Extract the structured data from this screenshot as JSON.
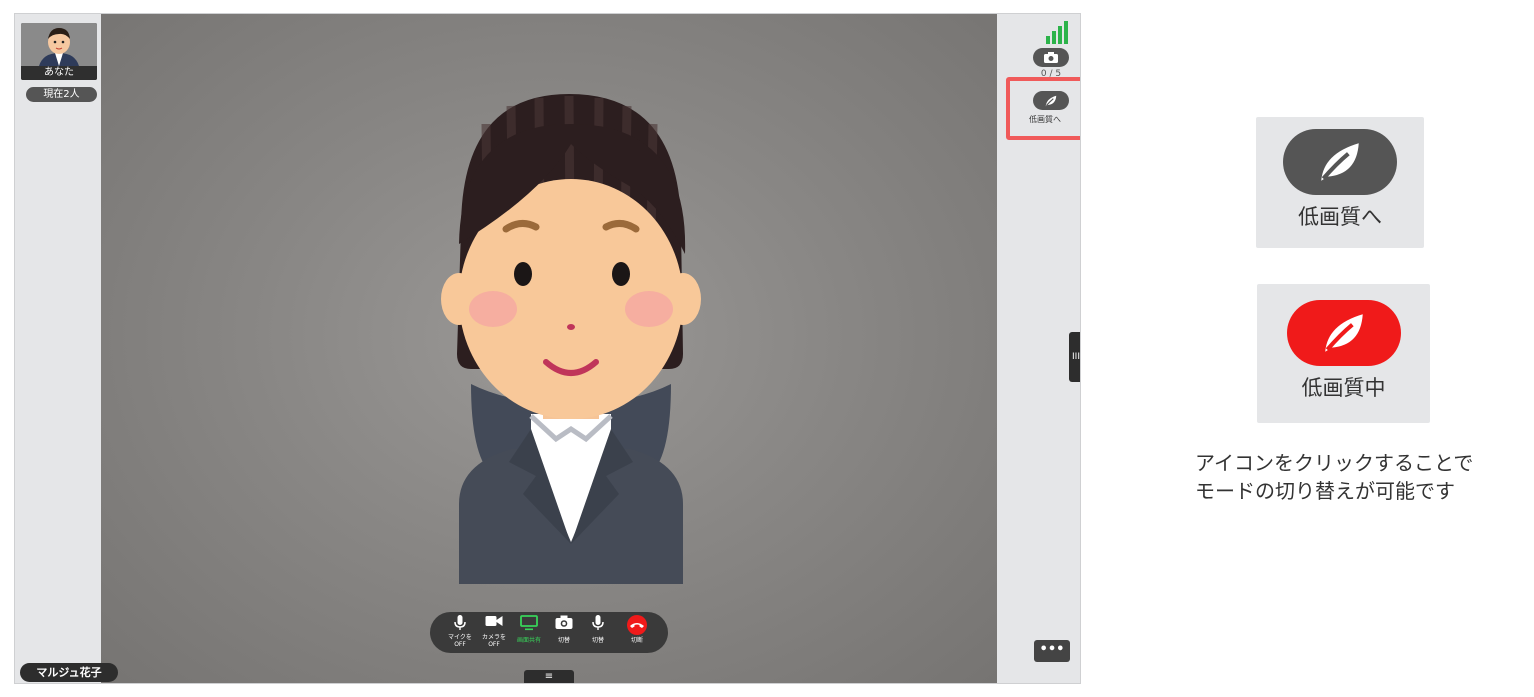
{
  "call": {
    "self_label": "あなた",
    "participant_count": "現在2人",
    "remote_name": "マルジュ花子"
  },
  "right_panel": {
    "screenshot_count": "0 / 5",
    "low_quality_button_label": "低画質へ",
    "more_label": "•••",
    "side_handle_label": "III"
  },
  "controls": [
    {
      "label_line1": "マイクを",
      "label_line2": "OFF",
      "icon": "mic-icon"
    },
    {
      "label_line1": "カメラを",
      "label_line2": "OFF",
      "icon": "camera-icon"
    },
    {
      "label_line1": "画面共有",
      "label_line2": "",
      "icon": "monitor-icon"
    },
    {
      "label_line1": "切替",
      "label_line2": "",
      "icon": "camera-switch-icon"
    },
    {
      "label_line1": "切替",
      "label_line2": "",
      "icon": "mic-switch-icon"
    },
    {
      "label_line1": "切断",
      "label_line2": "",
      "icon": "hangup-icon"
    }
  ],
  "bottom_toggle_label": "≡",
  "legend": {
    "low_quality_label": "低画質へ",
    "low_quality_active_label": "低画質中",
    "note_line1": "アイコンをクリックすることで",
    "note_line2": "モードの切り替えが可能です"
  },
  "colors": {
    "signal": "#2cb34a",
    "screen_share": "#38d45a",
    "hangup": "#f01a1a",
    "highlight": "#f05a5a",
    "pill_gray": "#555555"
  }
}
